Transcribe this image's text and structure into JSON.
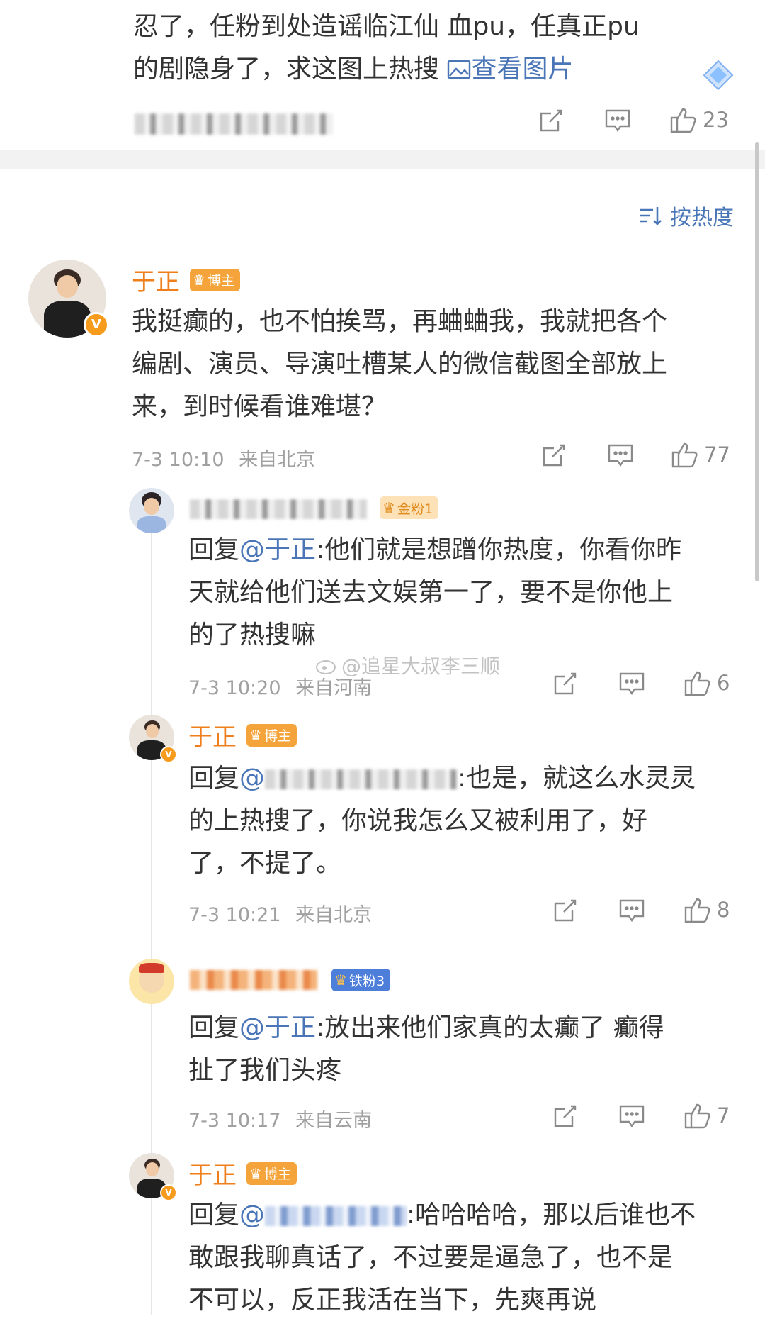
{
  "top_comment": {
    "line1": "忍了，任粉到处造谣临江仙 血pu，任真正pu",
    "line2": "的剧隐身了，求这图上热搜 ",
    "view_image": "查看图片",
    "likes": "23"
  },
  "sort": {
    "label": "按热度"
  },
  "main_comment": {
    "author": "于正",
    "badge": "博主",
    "text": [
      "我挺癫的，也不怕挨骂，再蛐蛐我，我就把各个",
      "编剧、演员、导演吐槽某人的微信截图全部放上",
      "来，到时候看谁难堪？"
    ],
    "time": "7-3 10:10",
    "location": "来自北京",
    "likes": "77"
  },
  "replies": [
    {
      "badge": "金粉1",
      "reply_prefix": "回复",
      "mention": "@于正",
      "text_first": ":他们就是想蹭你热度，你看你昨",
      "text_rest": [
        "天就给他们送去文娱第一了，要不是你他上",
        "的了热搜嘛"
      ],
      "time": "7-3 10:20",
      "location": "来自河南",
      "likes": "6"
    },
    {
      "author": "于正",
      "badge": "博主",
      "reply_prefix": "回复",
      "mention": "@",
      "text_first": ":也是，就这么水灵灵",
      "text_rest": [
        "的上热搜了，你说我怎么又被利用了，好",
        "了，不提了。"
      ],
      "time": "7-3 10:21",
      "location": "来自北京",
      "likes": "8"
    },
    {
      "badge": "铁粉3",
      "reply_prefix": "回复",
      "mention": "@于正",
      "text_first": ":放出来他们家真的太癫了 癫得",
      "text_rest": [
        "扯了我们头疼"
      ],
      "time": "7-3 10:17",
      "location": "来自云南",
      "likes": "7"
    },
    {
      "author": "于正",
      "badge": "博主",
      "reply_prefix": "回复",
      "mention": "@",
      "text_first": ":哈哈哈哈，那以后谁也不",
      "text_rest": [
        "敢跟我聊真话了，不过要是逼急了，也不是",
        "不可以，反正我活在当下，先爽再说"
      ]
    }
  ],
  "watermark": "@追星大叔李三顺",
  "colors": {
    "accent_orange": "#f07e1a",
    "link_blue": "#4a76b8",
    "meta_gray": "#a0a0a0"
  }
}
